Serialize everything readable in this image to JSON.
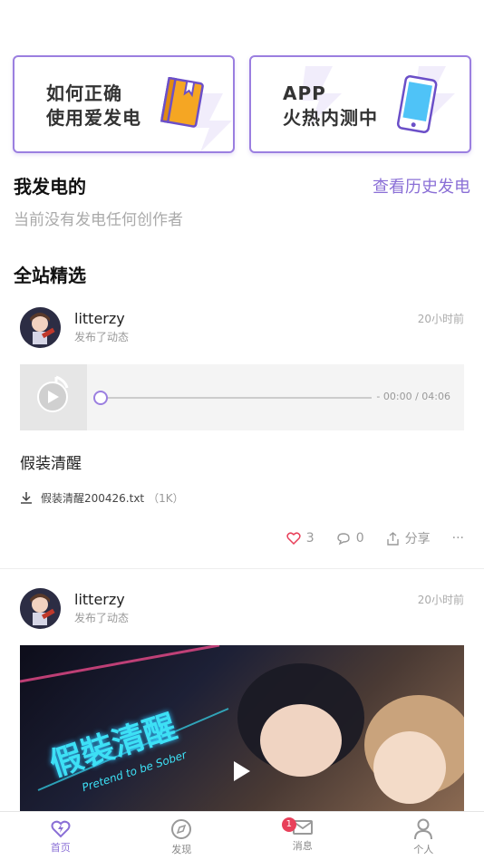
{
  "banners": [
    {
      "line1": "如何正确",
      "line2": "使用爱发电",
      "icon": "book-icon"
    },
    {
      "line1": "APP",
      "line2": "火热内测中",
      "icon": "phone-icon"
    }
  ],
  "my_support": {
    "title": "我发电的",
    "history_link": "查看历史发电",
    "empty_text": "当前没有发电任何创作者"
  },
  "featured": {
    "title": "全站精选",
    "posts": [
      {
        "username": "litterzy",
        "action": "发布了动态",
        "time": "20小时前",
        "audio_time": "- 00:00 / 04:06",
        "audio_progress": 0,
        "text": "假装清醒",
        "attachment_name": "假装清醒200426.txt",
        "attachment_size": "（1K）",
        "likes": "3",
        "comments": "0",
        "share_label": "分享",
        "more": "···"
      },
      {
        "username": "litterzy",
        "action": "发布了动态",
        "time": "20小时前",
        "video_title_overlay": "假裝清醒",
        "video_subtitle_overlay": "Pretend to be Sober"
      }
    ]
  },
  "tabbar": {
    "tabs": [
      {
        "label": "首页",
        "icon": "home-lightning-icon",
        "active": true
      },
      {
        "label": "发现",
        "icon": "compass-icon"
      },
      {
        "label": "消息",
        "icon": "mail-icon",
        "badge": "1"
      },
      {
        "label": "个人",
        "icon": "person-icon"
      }
    ]
  },
  "colors": {
    "accent": "#8a6fd6",
    "badge": "#e8405a"
  }
}
